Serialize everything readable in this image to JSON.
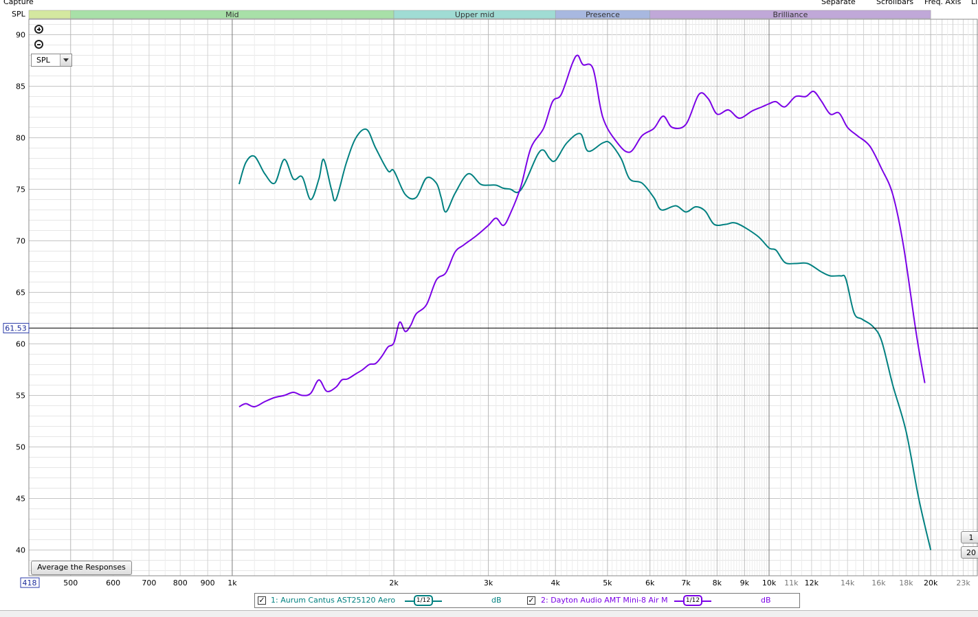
{
  "top_bar": {
    "capture_label": "Capture",
    "separate_label": "Separate",
    "scrollbars_label": "Scrollbars",
    "freq_axis_label": "Freq. Axis",
    "cut_label": "Li"
  },
  "side_controls": {
    "spl_axis_label": "SPL",
    "select_value": "SPL",
    "average_button": "Average the Responses",
    "cursor_value": "61.53",
    "x_start_value": "418"
  },
  "right_buttons": {
    "btn1": "1",
    "btn2": "20"
  },
  "bands": [
    {
      "name": "",
      "from": 418,
      "to": 500,
      "color": "#d4e8a0"
    },
    {
      "name": "Mid",
      "from": 500,
      "to": 2000,
      "color": "#a8e0a8"
    },
    {
      "name": "Upper mid",
      "from": 2000,
      "to": 4000,
      "color": "#a0dcd4"
    },
    {
      "name": "Presence",
      "from": 4000,
      "to": 6000,
      "color": "#a8b8e0"
    },
    {
      "name": "Brilliance",
      "from": 6000,
      "to": 20000,
      "color": "#c0a8d8"
    }
  ],
  "legend": {
    "items": [
      {
        "label": "1: Aurum Cantus AST25120 Aero",
        "smoothing": "1/12",
        "unit": "dB",
        "color": "#008080",
        "checked": "✓"
      },
      {
        "label": "2: Dayton Audio AMT Mini-8 Air M",
        "smoothing": "1/12",
        "unit": "dB",
        "color": "#7a00e6",
        "checked": "✓"
      }
    ]
  },
  "chart_data": {
    "type": "line",
    "xscale": "log",
    "xlim": [
      418,
      24500
    ],
    "ylim": [
      37.5,
      91.5
    ],
    "cursor_y": 61.53,
    "grid": true,
    "y_ticks": [
      40,
      45,
      50,
      55,
      60,
      65,
      70,
      75,
      80,
      85,
      90
    ],
    "x_ticks": [
      {
        "v": 418,
        "label": "418"
      },
      {
        "v": 500,
        "label": "500"
      },
      {
        "v": 600,
        "label": "600"
      },
      {
        "v": 700,
        "label": "700"
      },
      {
        "v": 800,
        "label": "800"
      },
      {
        "v": 900,
        "label": "900"
      },
      {
        "v": 1000,
        "label": "1k"
      },
      {
        "v": 2000,
        "label": "2k"
      },
      {
        "v": 3000,
        "label": "3k"
      },
      {
        "v": 4000,
        "label": "4k"
      },
      {
        "v": 5000,
        "label": "5k"
      },
      {
        "v": 6000,
        "label": "6k"
      },
      {
        "v": 7000,
        "label": "7k"
      },
      {
        "v": 8000,
        "label": "8k"
      },
      {
        "v": 9000,
        "label": "9k"
      },
      {
        "v": 10000,
        "label": "10k"
      },
      {
        "v": 11000,
        "label": "11k"
      },
      {
        "v": 12000,
        "label": "12k"
      },
      {
        "v": 14000,
        "label": "14k"
      },
      {
        "v": 16000,
        "label": "16k"
      },
      {
        "v": 18000,
        "label": "18k"
      },
      {
        "v": 20000,
        "label": "20k"
      },
      {
        "v": 23000,
        "label": "23k"
      }
    ],
    "series": [
      {
        "name": "1: Aurum Cantus AST25120 Aero",
        "color": "#008080",
        "points": [
          [
            1030,
            75.5
          ],
          [
            1060,
            77.6
          ],
          [
            1100,
            78.2
          ],
          [
            1150,
            76.5
          ],
          [
            1200,
            75.6
          ],
          [
            1250,
            77.9
          ],
          [
            1300,
            76.0
          ],
          [
            1350,
            76.2
          ],
          [
            1400,
            74.0
          ],
          [
            1450,
            76.0
          ],
          [
            1480,
            77.9
          ],
          [
            1530,
            75.0
          ],
          [
            1560,
            74.0
          ],
          [
            1630,
            77.5
          ],
          [
            1700,
            80.0
          ],
          [
            1780,
            80.8
          ],
          [
            1850,
            79.0
          ],
          [
            1950,
            76.8
          ],
          [
            2000,
            76.8
          ],
          [
            2100,
            74.5
          ],
          [
            2200,
            74.2
          ],
          [
            2300,
            76.1
          ],
          [
            2400,
            75.6
          ],
          [
            2450,
            74.2
          ],
          [
            2500,
            72.8
          ],
          [
            2600,
            74.6
          ],
          [
            2750,
            76.5
          ],
          [
            2900,
            75.5
          ],
          [
            3000,
            75.4
          ],
          [
            3100,
            75.4
          ],
          [
            3200,
            75.1
          ],
          [
            3300,
            75.0
          ],
          [
            3400,
            74.7
          ],
          [
            3500,
            75.5
          ],
          [
            3700,
            78.3
          ],
          [
            3800,
            78.8
          ],
          [
            3900,
            78.0
          ],
          [
            4000,
            77.8
          ],
          [
            4200,
            79.5
          ],
          [
            4450,
            80.4
          ],
          [
            4600,
            78.7
          ],
          [
            4900,
            79.5
          ],
          [
            5050,
            79.5
          ],
          [
            5300,
            78.0
          ],
          [
            5500,
            76.0
          ],
          [
            5800,
            75.6
          ],
          [
            6100,
            74.2
          ],
          [
            6300,
            73.0
          ],
          [
            6700,
            73.4
          ],
          [
            7000,
            72.8
          ],
          [
            7300,
            73.3
          ],
          [
            7600,
            72.9
          ],
          [
            7900,
            71.6
          ],
          [
            8300,
            71.6
          ],
          [
            8700,
            71.7
          ],
          [
            9500,
            70.5
          ],
          [
            10000,
            69.3
          ],
          [
            10300,
            69.1
          ],
          [
            10700,
            67.9
          ],
          [
            11200,
            67.8
          ],
          [
            11800,
            67.8
          ],
          [
            12500,
            67.0
          ],
          [
            13000,
            66.6
          ],
          [
            13600,
            66.6
          ],
          [
            13900,
            66.3
          ],
          [
            14400,
            63.0
          ],
          [
            14900,
            62.4
          ],
          [
            15600,
            61.7
          ],
          [
            16200,
            60.3
          ],
          [
            17000,
            56.0
          ],
          [
            18000,
            51.5
          ],
          [
            19000,
            45.0
          ],
          [
            20000,
            40.0
          ]
        ]
      },
      {
        "name": "2: Dayton Audio AMT Mini-8 Air M",
        "color": "#7a00e6",
        "points": [
          [
            1030,
            53.9
          ],
          [
            1060,
            54.2
          ],
          [
            1100,
            53.9
          ],
          [
            1150,
            54.4
          ],
          [
            1200,
            54.8
          ],
          [
            1250,
            55.0
          ],
          [
            1300,
            55.3
          ],
          [
            1350,
            55.0
          ],
          [
            1400,
            55.2
          ],
          [
            1450,
            56.5
          ],
          [
            1500,
            55.4
          ],
          [
            1560,
            55.8
          ],
          [
            1600,
            56.5
          ],
          [
            1640,
            56.6
          ],
          [
            1700,
            57.1
          ],
          [
            1750,
            57.5
          ],
          [
            1800,
            58.0
          ],
          [
            1850,
            58.1
          ],
          [
            1900,
            58.8
          ],
          [
            1950,
            59.7
          ],
          [
            2000,
            60.1
          ],
          [
            2050,
            62.1
          ],
          [
            2100,
            61.2
          ],
          [
            2150,
            61.8
          ],
          [
            2200,
            62.9
          ],
          [
            2300,
            63.8
          ],
          [
            2400,
            66.2
          ],
          [
            2500,
            66.9
          ],
          [
            2600,
            68.9
          ],
          [
            2700,
            69.6
          ],
          [
            2850,
            70.5
          ],
          [
            3000,
            71.5
          ],
          [
            3100,
            72.2
          ],
          [
            3200,
            71.5
          ],
          [
            3300,
            72.7
          ],
          [
            3450,
            75.3
          ],
          [
            3600,
            79.0
          ],
          [
            3800,
            80.9
          ],
          [
            3950,
            83.5
          ],
          [
            4100,
            84.2
          ],
          [
            4300,
            87.2
          ],
          [
            4400,
            88.0
          ],
          [
            4500,
            87.1
          ],
          [
            4700,
            86.7
          ],
          [
            4900,
            82.0
          ],
          [
            5200,
            79.6
          ],
          [
            5500,
            78.6
          ],
          [
            5800,
            80.2
          ],
          [
            6100,
            80.9
          ],
          [
            6350,
            82.1
          ],
          [
            6600,
            81.0
          ],
          [
            7000,
            81.3
          ],
          [
            7400,
            84.2
          ],
          [
            7700,
            83.8
          ],
          [
            8000,
            82.3
          ],
          [
            8400,
            82.7
          ],
          [
            8800,
            81.9
          ],
          [
            9300,
            82.6
          ],
          [
            9700,
            83.0
          ],
          [
            10000,
            83.3
          ],
          [
            10300,
            83.5
          ],
          [
            10700,
            83.0
          ],
          [
            11200,
            84.0
          ],
          [
            11700,
            84.0
          ],
          [
            12100,
            84.5
          ],
          [
            12500,
            83.6
          ],
          [
            13000,
            82.3
          ],
          [
            13500,
            82.4
          ],
          [
            14000,
            81.0
          ],
          [
            14600,
            80.2
          ],
          [
            15400,
            79.2
          ],
          [
            16200,
            77.0
          ],
          [
            17000,
            74.5
          ],
          [
            17800,
            69.5
          ],
          [
            18800,
            61.0
          ],
          [
            19500,
            56.2
          ]
        ]
      }
    ]
  }
}
